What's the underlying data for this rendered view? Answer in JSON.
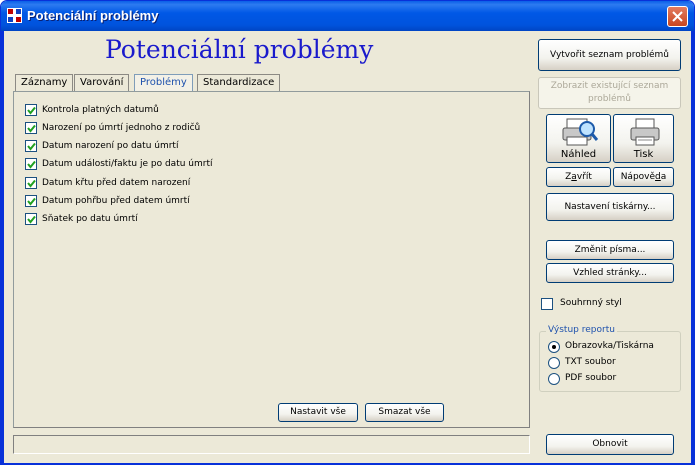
{
  "window": {
    "title": "Potenciální problémy",
    "heading": "Potenciální problémy"
  },
  "tabs": [
    {
      "label": "Záznamy",
      "active": false
    },
    {
      "label": "Varování",
      "active": false
    },
    {
      "label": "Problémy",
      "active": true
    },
    {
      "label": "Standardizace",
      "active": false
    }
  ],
  "checks": [
    {
      "label": "Kontrola platných datumů",
      "checked": true
    },
    {
      "label": "Narození po úmrtí jednoho z rodičů",
      "checked": true
    },
    {
      "label": "Datum narození po datu úmrtí",
      "checked": true
    },
    {
      "label": "Datum události/faktu je po datu úmrtí",
      "checked": true
    },
    {
      "label": "Datum křtu před datem narození",
      "checked": true
    },
    {
      "label": "Datum pohřbu před datem úmrtí",
      "checked": true
    },
    {
      "label": "Sňatek po datu úmrtí",
      "checked": true
    }
  ],
  "panel_buttons": {
    "set_all": "Nastavit vše",
    "clear_all": "Smazat vše"
  },
  "side": {
    "create_list": "Vytvořit seznam problémů",
    "show_existing": "Zobrazit existující seznam problémů",
    "preview": "Náhled",
    "print": "Tisk",
    "close_pre": "Z",
    "close_ul": "a",
    "close_post": "vřít",
    "help_pre": "Nápově",
    "help_ul": "d",
    "help_post": "a",
    "printer_setup": "Nastavení tiskárny...",
    "change_fonts": "Změnit písma...",
    "page_layout": "Vzhled stránky...",
    "summary_style": "Souhrnný styl",
    "refresh": "Obnovit"
  },
  "output": {
    "title": "Výstup reportu",
    "options": [
      {
        "label": "Obrazovka/Tiskárna",
        "selected": true
      },
      {
        "label": "TXT soubor",
        "selected": false
      },
      {
        "label": "PDF soubor",
        "selected": false
      }
    ]
  },
  "colors": {
    "titlebar": "#0058E6",
    "heading": "#1A1ACC",
    "active_tab": "#1F52AD",
    "window_bg": "#ECE9D8"
  }
}
